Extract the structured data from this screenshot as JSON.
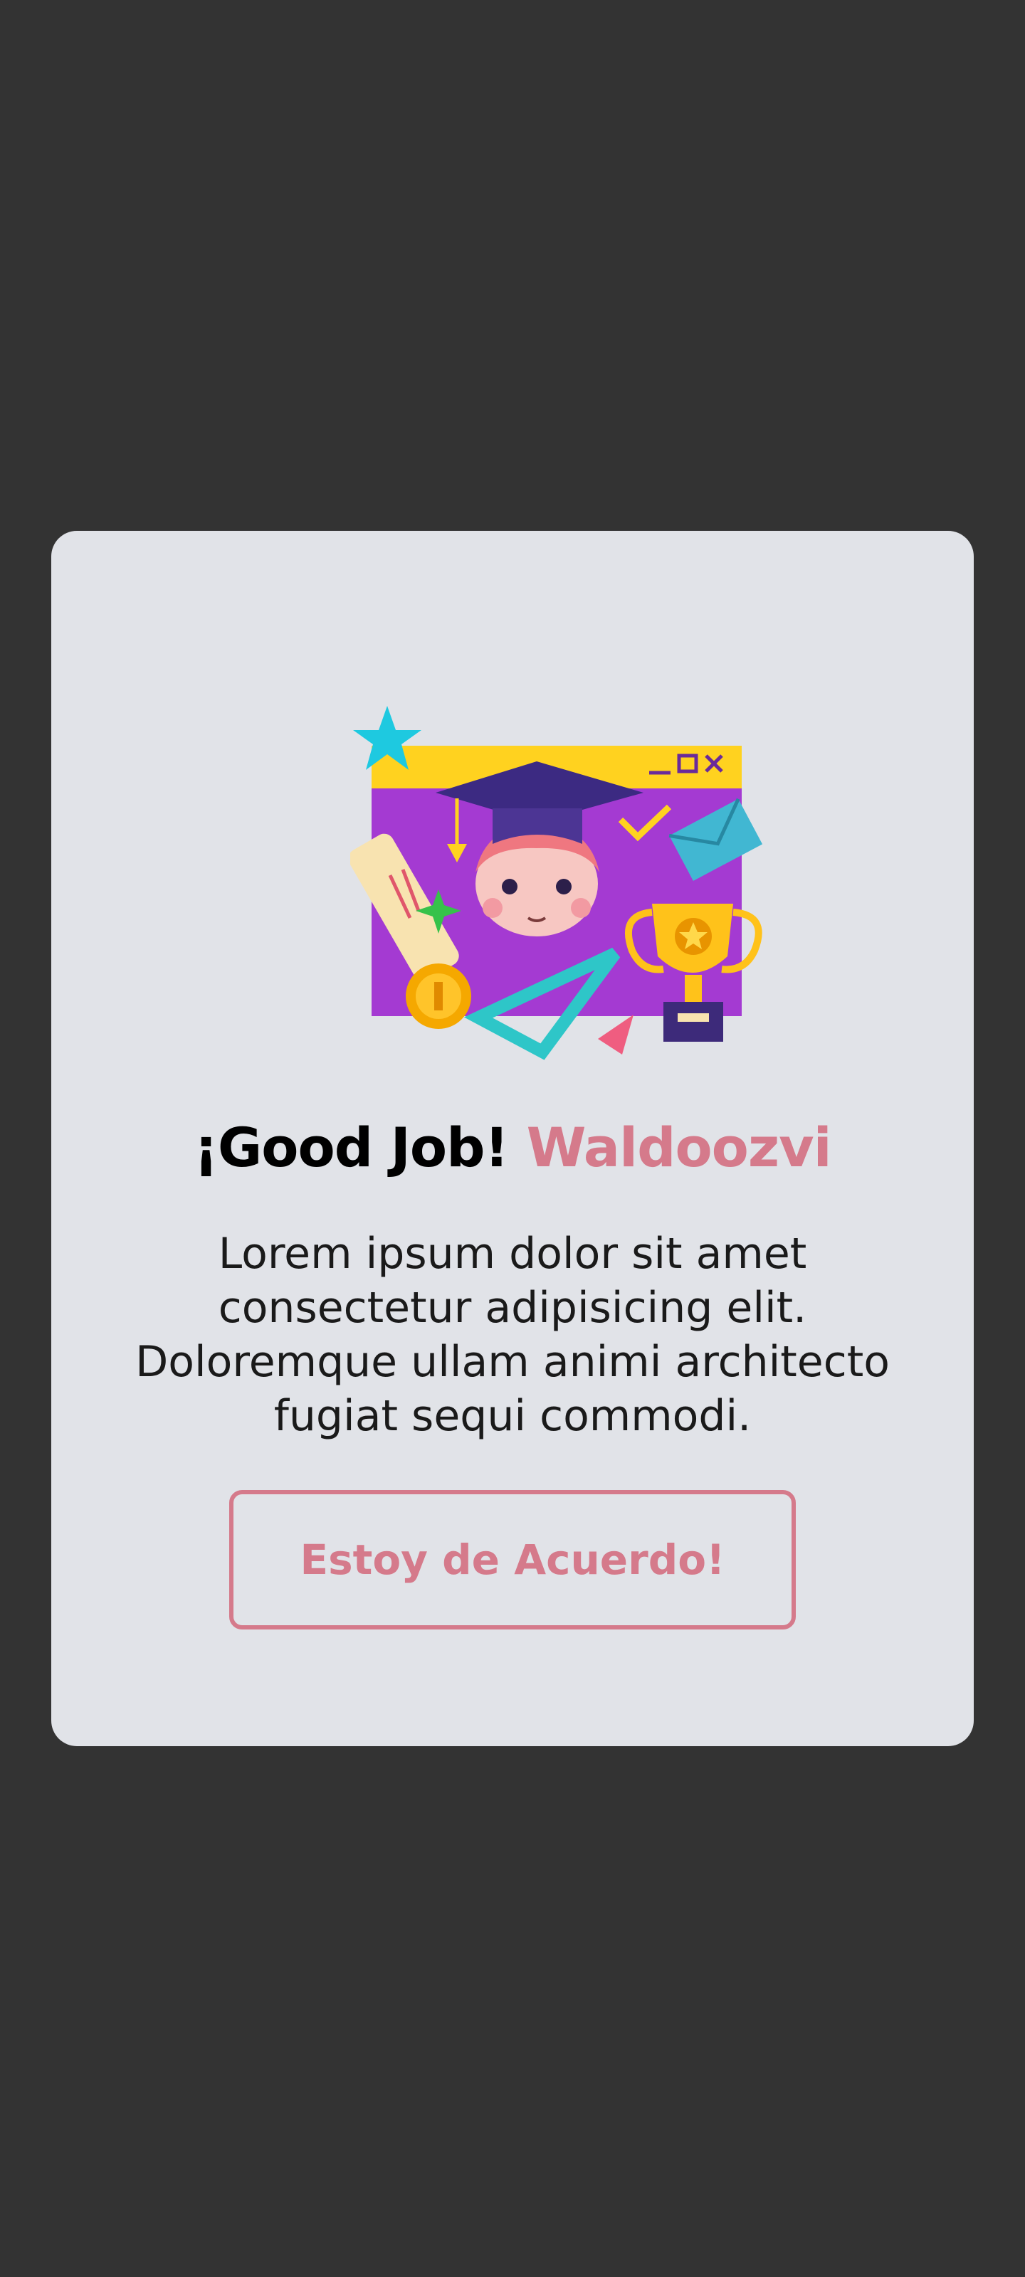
{
  "dialog": {
    "title_prefix": "¡Good Job!",
    "title_name": "Waldoozvi",
    "message": "Lorem ipsum dolor sit amet consectetur adipisicing elit. Doloremque ullam animi architecto fugiat sequi commodi.",
    "button_label": "Estoy de Acuerdo!",
    "illustration_icon": "graduation-achievement-illustration"
  },
  "colors": {
    "backdrop": "#333333",
    "card": "#e1e3e8",
    "accent": "#d57a8b",
    "text": "#000000"
  }
}
